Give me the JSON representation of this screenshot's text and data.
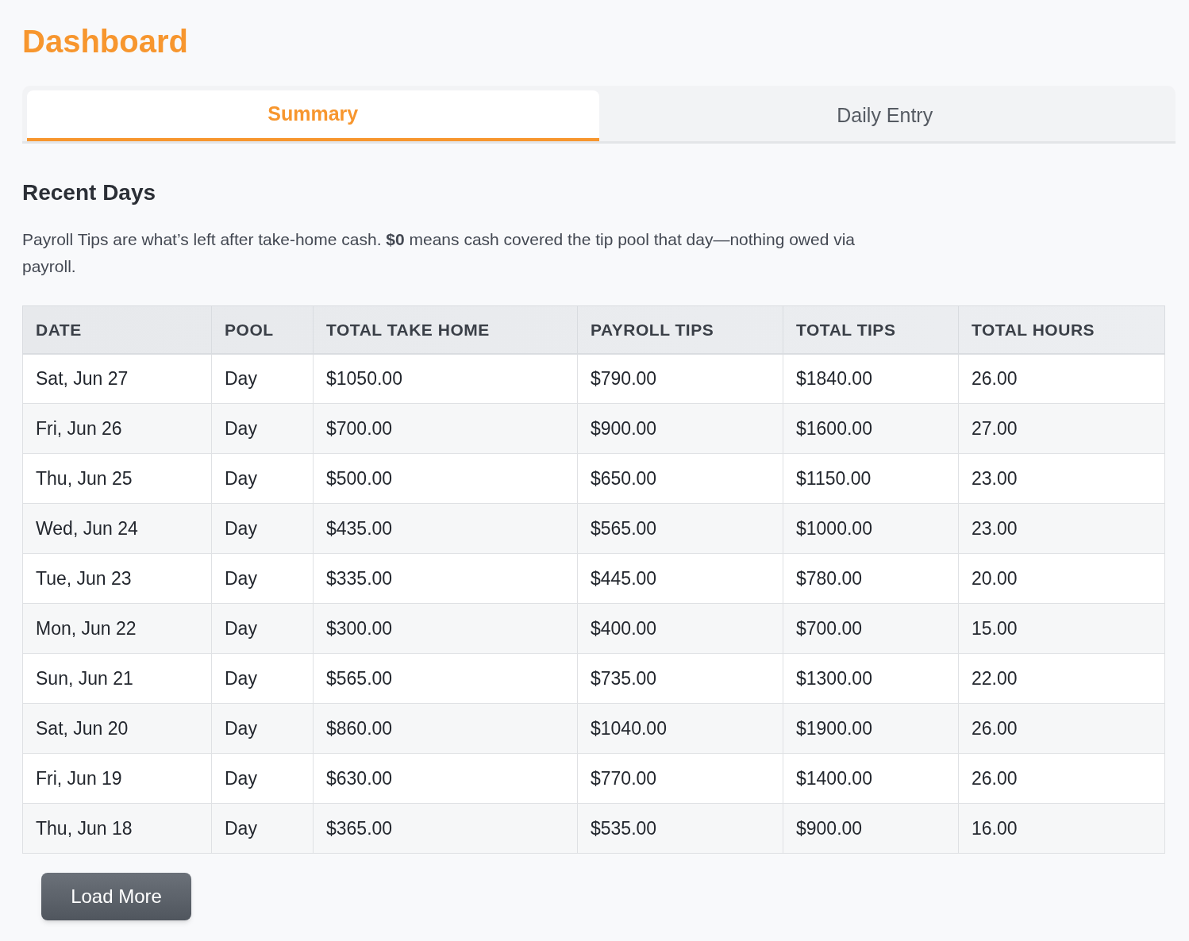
{
  "title": "Dashboard",
  "tabs": [
    {
      "label": "Summary",
      "selected": true
    },
    {
      "label": "Daily Entry",
      "selected": false
    }
  ],
  "section": {
    "heading": "Recent Days",
    "note": "Payroll Tips are what’s left after take-home cash. **$0** means cash covered the tip pool that day—nothing owed via payroll."
  },
  "table": {
    "columns": [
      "DATE",
      "POOL",
      "TOTAL TAKE HOME",
      "PAYROLL TIPS",
      "TOTAL TIPS",
      "TOTAL HOURS"
    ],
    "rows": [
      [
        "Sat, Jun 27",
        "Day",
        "$1050.00",
        "$790.00",
        "$1840.00",
        "26.00"
      ],
      [
        "Fri, Jun 26",
        "Day",
        "$700.00",
        "$900.00",
        "$1600.00",
        "27.00"
      ],
      [
        "Thu, Jun 25",
        "Day",
        "$500.00",
        "$650.00",
        "$1150.00",
        "23.00"
      ],
      [
        "Wed, Jun 24",
        "Day",
        "$435.00",
        "$565.00",
        "$1000.00",
        "23.00"
      ],
      [
        "Tue, Jun 23",
        "Day",
        "$335.00",
        "$445.00",
        "$780.00",
        "20.00"
      ],
      [
        "Mon, Jun 22",
        "Day",
        "$300.00",
        "$400.00",
        "$700.00",
        "15.00"
      ],
      [
        "Sun, Jun 21",
        "Day",
        "$565.00",
        "$735.00",
        "$1300.00",
        "22.00"
      ],
      [
        "Sat, Jun 20",
        "Day",
        "$860.00",
        "$1040.00",
        "$1900.00",
        "26.00"
      ],
      [
        "Fri, Jun 19",
        "Day",
        "$630.00",
        "$770.00",
        "$1400.00",
        "26.00"
      ],
      [
        "Thu, Jun 18",
        "Day",
        "$365.00",
        "$535.00",
        "$900.00",
        "16.00"
      ]
    ]
  },
  "load_more": "Load More"
}
